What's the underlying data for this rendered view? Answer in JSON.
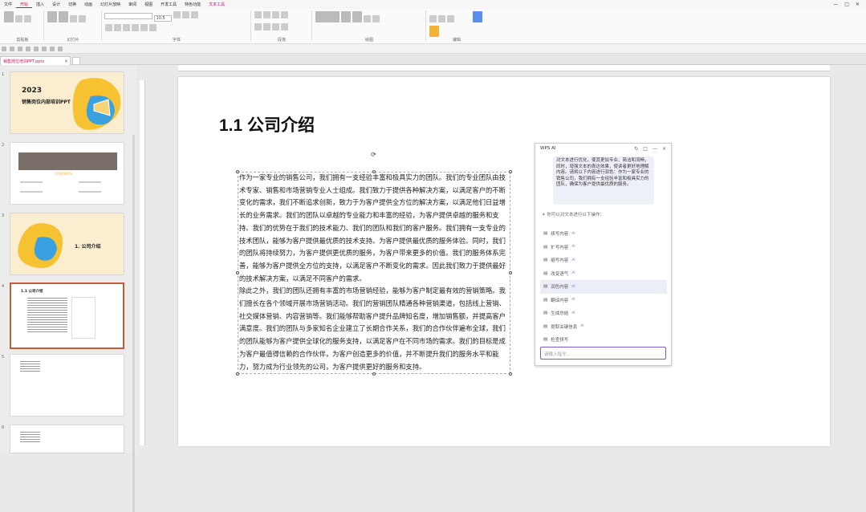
{
  "menu": {
    "items": [
      "文件",
      "开始",
      "插入",
      "设计",
      "切换",
      "动画",
      "幻灯片放映",
      "审阅",
      "视图",
      "开发工具",
      "特色功能",
      "文本工具"
    ],
    "window_controls": [
      "最小化",
      "最大化",
      "关闭"
    ]
  },
  "ribbon": {
    "font_name": "",
    "font_size": "10.5",
    "groups": [
      "剪贴板",
      "幻灯片",
      "字体",
      "段落",
      "绘图",
      "编辑"
    ]
  },
  "file_tab": {
    "label": "销售岗位培训PPT.pptx",
    "close": "×"
  },
  "thumbnails": [
    {
      "num": "1",
      "year": "2023",
      "title": "销售岗位内部培训PPT"
    },
    {
      "num": "2",
      "title": "CONTENTS"
    },
    {
      "num": "3",
      "title": "1. 公司介绍"
    },
    {
      "num": "4",
      "title": "1.1 公司介绍"
    },
    {
      "num": "5",
      "title": ""
    },
    {
      "num": "6",
      "title": ""
    }
  ],
  "slide": {
    "title": "1.1 公司介绍",
    "paragraphs": [
      "作为一家专业的销售公司，我们拥有一支经验丰富和极具实力的团队。我们的专业团队由技术专家、销售和市场营销专业人士组成。我们致力于提供各种解决方案，以满足客户的不断变化的需求，我们不断追求创新，致力于为客户提供全方位的解决方案，以满足他们日益增长的业务需求。我们的团队以卓越的专业能力和丰富的经验，为客户提供卓越的服务和支持。我们的优势在于我们的技术能力、我们的团队和我们的客户服务。我们拥有一支专业的技术团队，能够为客户提供最优质的技术支持。为客户提供最优质的服务体验。同时，我们的团队将持续努力，为客户提供更优质的服务，为客户带来更多的价值。我们的服务体系完善，能够为客户提供全方位的支持，以满足客户不断变化的需求。因此我们致力于提供最好的技术解决方案，以满足不同客户的需求。",
      "除此之外，我们的团队还拥有丰富的市场营销经验，能够为客户制定最有效的营销策略。我们擅长在各个领域开展市场营销活动。我们的营销团队精通各种营销渠道，包括线上营销、社交媒体营销、内容营销等。我们能够帮助客户提升品牌知名度，增加销售额，并提高客户满意度。我们的团队与多家知名企业建立了长期合作关系，我们的合作伙伴遍布全球，我们的团队能够为客户提供全球化的服务支持，以满足客户在不同市场的需求。我们的目标是成为客户最值得信赖的合作伙伴，为客户创造更多的价值，并不断提升我们的服务水平和能力，努力成为行业领先的公司，为客户提供更好的服务和支持。"
    ]
  },
  "ai_panel": {
    "title": "WPS AI",
    "controls": [
      "↻",
      "□",
      "—",
      "×"
    ],
    "response": "对文本进行优化，使其更加专业、简洁和流畅，同时，增强文本的表达效果，使读者更好地理解内容。请将以下内容进行润色：作为一家专业的销售公司，我们拥有一支经验丰富和极具实力的团队，确保为客户提供最优质的服务。",
    "prompt": "你可以对文本进行以下操作：",
    "commands": [
      {
        "label": "续写内容",
        "tag": "AI"
      },
      {
        "label": "扩写内容",
        "tag": "AI"
      },
      {
        "label": "缩写内容",
        "tag": "AI"
      },
      {
        "label": "改变语气",
        "tag": "AI"
      },
      {
        "label": "润色内容",
        "tag": "AI"
      },
      {
        "label": "翻译内容",
        "tag": "AI"
      },
      {
        "label": "生成总结",
        "tag": "AI"
      },
      {
        "label": "提取关键信息",
        "tag": "AI"
      },
      {
        "label": "检查拼写",
        "tag": ""
      }
    ],
    "selected_index": 4,
    "input_placeholder": "请输入指令..."
  }
}
